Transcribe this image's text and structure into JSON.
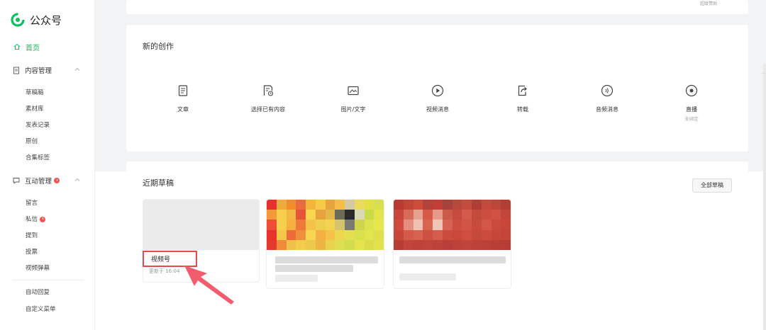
{
  "app": {
    "name": "公众号"
  },
  "sidebar": {
    "home": "首页",
    "content_group": "内容管理",
    "content_items": [
      "草稿箱",
      "素材库",
      "发表记录",
      "原创",
      "合集标签"
    ],
    "interact_group": "互动管理",
    "interact_items": [
      "留言",
      "私信",
      "提到",
      "投票",
      "视频弹幕"
    ],
    "other_items": [
      "自动回复",
      "自定义菜单"
    ]
  },
  "top_card": {
    "text": "超级赞助"
  },
  "create": {
    "title": "新的创作",
    "items": [
      {
        "label": "文章",
        "icon": "article-icon"
      },
      {
        "label": "选择已有内容",
        "icon": "existing-content-icon"
      },
      {
        "label": "图片/文字",
        "icon": "image-text-icon"
      },
      {
        "label": "视频消息",
        "icon": "video-play-icon"
      },
      {
        "label": "转载",
        "icon": "repost-icon"
      },
      {
        "label": "音频消息",
        "icon": "audio-icon"
      },
      {
        "label": "直播",
        "icon": "live-icon",
        "sublabel": "未绑定"
      }
    ]
  },
  "drafts": {
    "title": "近期草稿",
    "all_button": "全部草稿",
    "items": [
      {
        "title": "视频号",
        "time": "更新于 16:04"
      }
    ]
  },
  "colors": {
    "accent": "#07c160",
    "highlight": "#e84a4a",
    "arrow": "#f25d6e",
    "badge": "#fa5151"
  }
}
